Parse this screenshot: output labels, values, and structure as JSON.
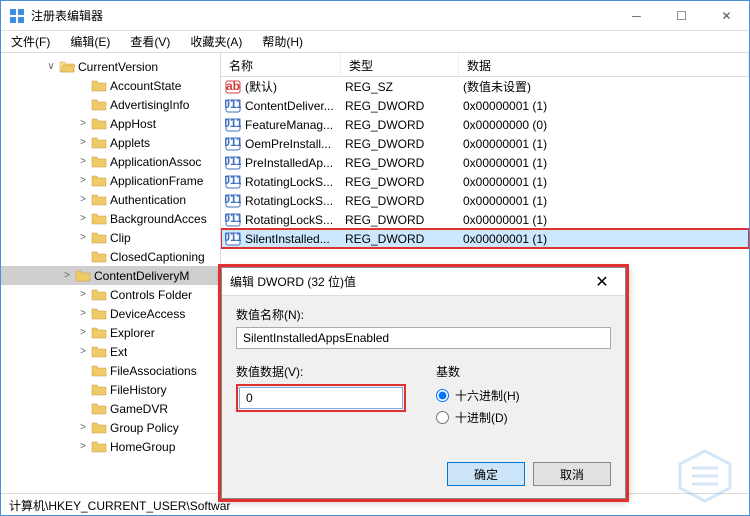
{
  "window": {
    "title": "注册表编辑器"
  },
  "menubar": {
    "file": "文件(F)",
    "edit": "编辑(E)",
    "view": "查看(V)",
    "favorites": "收藏夹(A)",
    "help": "帮助(H)"
  },
  "tree": {
    "items": [
      {
        "label": "CurrentVersion",
        "indent": 42,
        "expand": "∨",
        "open": true,
        "selected": false
      },
      {
        "label": "AccountState",
        "indent": 74,
        "expand": "",
        "selected": false
      },
      {
        "label": "AdvertisingInfo",
        "indent": 74,
        "expand": "",
        "selected": false
      },
      {
        "label": "AppHost",
        "indent": 74,
        "expand": ">",
        "selected": false
      },
      {
        "label": "Applets",
        "indent": 74,
        "expand": ">",
        "selected": false
      },
      {
        "label": "ApplicationAssoc",
        "indent": 74,
        "expand": ">",
        "selected": false
      },
      {
        "label": "ApplicationFrame",
        "indent": 74,
        "expand": ">",
        "selected": false
      },
      {
        "label": "Authentication",
        "indent": 74,
        "expand": ">",
        "selected": false
      },
      {
        "label": "BackgroundAcces",
        "indent": 74,
        "expand": ">",
        "selected": false
      },
      {
        "label": "Clip",
        "indent": 74,
        "expand": ">",
        "selected": false
      },
      {
        "label": "ClosedCaptioning",
        "indent": 74,
        "expand": "",
        "selected": false
      },
      {
        "label": "ContentDeliveryM",
        "indent": 58,
        "expand": ">",
        "selected": true
      },
      {
        "label": "Controls Folder",
        "indent": 74,
        "expand": ">",
        "selected": false
      },
      {
        "label": "DeviceAccess",
        "indent": 74,
        "expand": ">",
        "selected": false
      },
      {
        "label": "Explorer",
        "indent": 74,
        "expand": ">",
        "selected": false
      },
      {
        "label": "Ext",
        "indent": 74,
        "expand": ">",
        "selected": false
      },
      {
        "label": "FileAssociations",
        "indent": 74,
        "expand": "",
        "selected": false
      },
      {
        "label": "FileHistory",
        "indent": 74,
        "expand": "",
        "selected": false
      },
      {
        "label": "GameDVR",
        "indent": 74,
        "expand": "",
        "selected": false
      },
      {
        "label": "Group Policy",
        "indent": 74,
        "expand": ">",
        "selected": false
      },
      {
        "label": "HomeGroup",
        "indent": 74,
        "expand": ">",
        "selected": false
      }
    ]
  },
  "list": {
    "headers": {
      "name": "名称",
      "type": "类型",
      "data": "数据"
    },
    "rows": [
      {
        "icon": "string",
        "name": "(默认)",
        "type": "REG_SZ",
        "data": "(数值未设置)",
        "highlighted": false
      },
      {
        "icon": "binary",
        "name": "ContentDeliver...",
        "type": "REG_DWORD",
        "data": "0x00000001 (1)",
        "highlighted": false
      },
      {
        "icon": "binary",
        "name": "FeatureManag...",
        "type": "REG_DWORD",
        "data": "0x00000000 (0)",
        "highlighted": false
      },
      {
        "icon": "binary",
        "name": "OemPreInstall...",
        "type": "REG_DWORD",
        "data": "0x00000001 (1)",
        "highlighted": false
      },
      {
        "icon": "binary",
        "name": "PreInstalledAp...",
        "type": "REG_DWORD",
        "data": "0x00000001 (1)",
        "highlighted": false
      },
      {
        "icon": "binary",
        "name": "RotatingLockS...",
        "type": "REG_DWORD",
        "data": "0x00000001 (1)",
        "highlighted": false
      },
      {
        "icon": "binary",
        "name": "RotatingLockS...",
        "type": "REG_DWORD",
        "data": "0x00000001 (1)",
        "highlighted": false
      },
      {
        "icon": "binary",
        "name": "RotatingLockS...",
        "type": "REG_DWORD",
        "data": "0x00000001 (1)",
        "highlighted": false
      },
      {
        "icon": "binary",
        "name": "SilentInstalled...",
        "type": "REG_DWORD",
        "data": "0x00000001 (1)",
        "highlighted": true
      }
    ]
  },
  "statusbar": {
    "path": "计算机\\HKEY_CURRENT_USER\\Softwar"
  },
  "dialog": {
    "title": "编辑 DWORD (32 位)值",
    "name_label": "数值名称(N):",
    "name_value": "SilentInstalledAppsEnabled",
    "value_label": "数值数据(V):",
    "value_value": "0",
    "base_label": "基数",
    "radio_hex": "十六进制(H)",
    "radio_dec": "十进制(D)",
    "ok": "确定",
    "cancel": "取消"
  }
}
